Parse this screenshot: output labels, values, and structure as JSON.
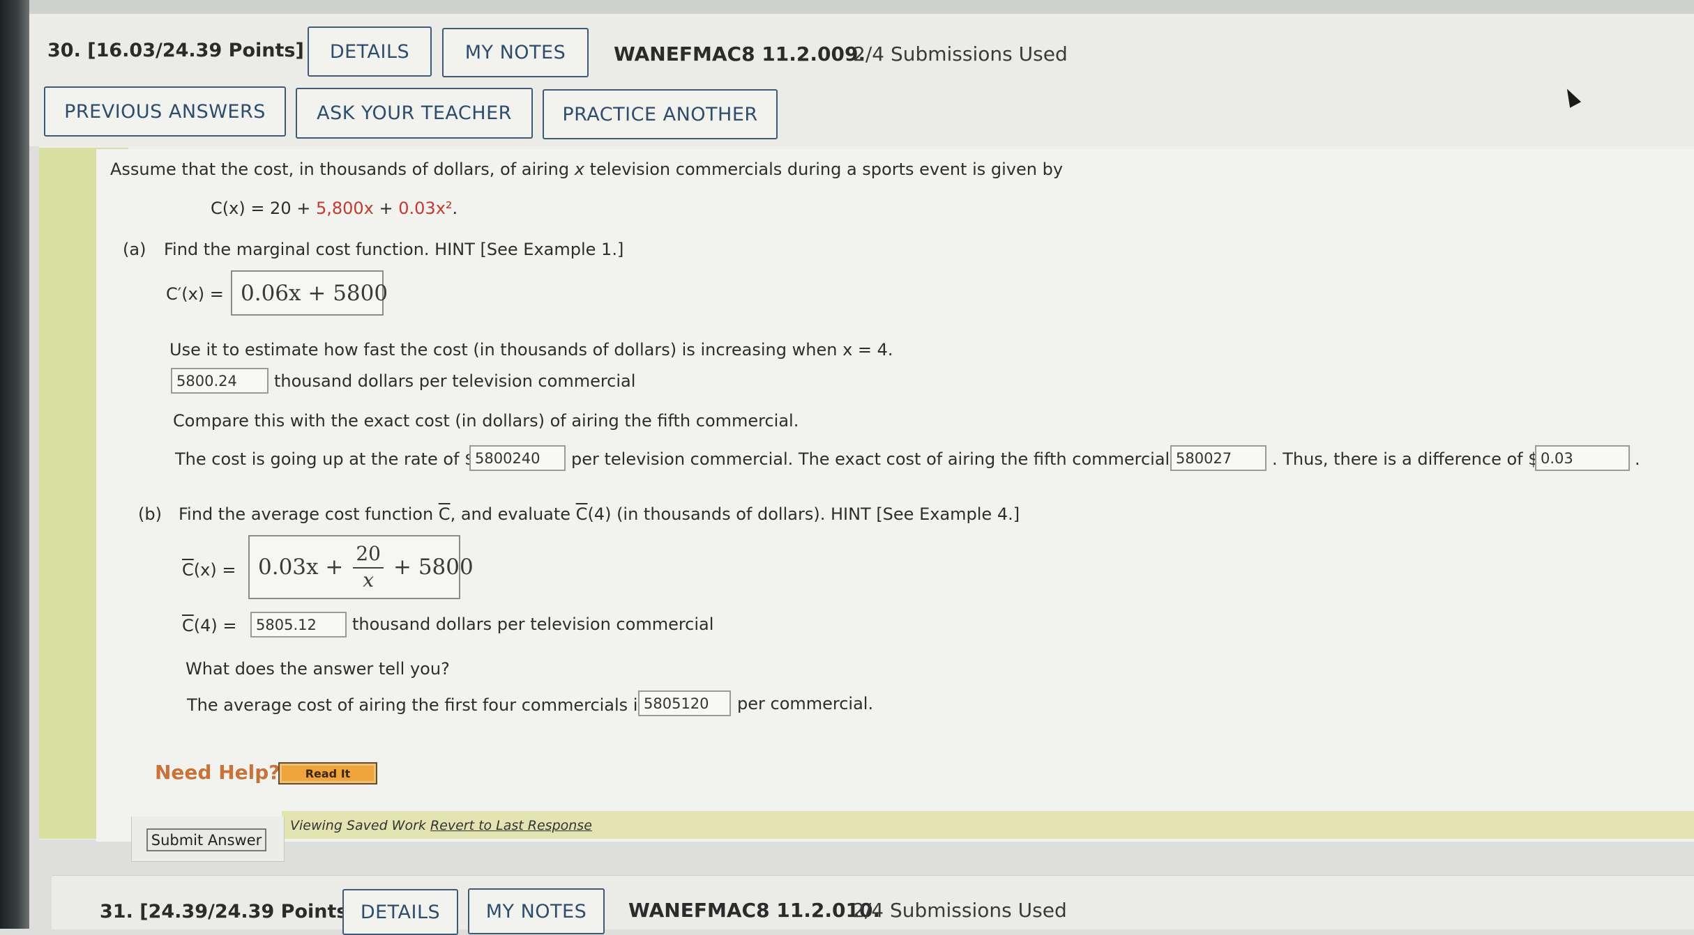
{
  "q30": {
    "number": "30.",
    "points": "[16.03/24.39 Points]",
    "details_label": "DETAILS",
    "notes_label": "MY NOTES",
    "code": "WANEFMAC8 11.2.009.",
    "submissions": "2/4 Submissions Used",
    "prev_answers_label": "PREVIOUS ANSWERS",
    "ask_teacher_label": "ASK YOUR TEACHER",
    "practice_label": "PRACTICE ANOTHER"
  },
  "problem": {
    "intro_a": "Assume that the cost, in thousands of dollars, of airing ",
    "intro_var": "x",
    "intro_b": " television commercials during a sports event is given by",
    "eq_prefix": "C(x) = 20 + ",
    "eq_term1": "5,800x",
    "eq_mid": " + ",
    "eq_term2": "0.03x²",
    "eq_end": ".",
    "part_a_label": "(a)",
    "part_a_text": "Find the marginal cost function. HINT [See Example 1.]",
    "marginal_lhs": "C′(x) =",
    "marginal_answer": "0.06x + 5800",
    "estimate_text": "Use it to estimate how fast the cost (in thousands of dollars) is increasing when x = 4.",
    "estimate_value": "5800.24",
    "estimate_unit": "thousand dollars per television commercial",
    "compare_text": "Compare this with the exact cost (in dollars) of airing the fifth commercial.",
    "rate_text_1": "The cost is going up at the rate of $",
    "rate_value": "5800240",
    "rate_text_2": "per television commercial. The exact cost of airing the fifth commercial is $",
    "exact_value": "580027",
    "rate_text_3": ". Thus, there is a difference of $",
    "difference_value": "0.03",
    "rate_text_4": ".",
    "part_b_label": "(b)",
    "part_b_text_1": "Find the average cost function ",
    "part_b_c": "C",
    "part_b_text_2": ", and evaluate ",
    "part_b_text_3": "(4) (in thousands of dollars). HINT [See Example 4.]",
    "avg_lhs_c": "C",
    "avg_lhs_rest": "(x) =",
    "avg_term1": "0.03x +",
    "avg_frac_num": "20",
    "avg_frac_den": "x",
    "avg_term2": "+ 5800",
    "avg4_lhs_c": "C",
    "avg4_lhs_rest": "(4) =",
    "avg4_value": "5805.12",
    "avg4_unit": "thousand dollars per television commercial",
    "question_text": "What does the answer tell you?",
    "avg_cost_text_1": "The average cost of airing the first four commercials is $",
    "avg_cost_value": "5805120",
    "avg_cost_text_2": "per commercial."
  },
  "help": {
    "need_help": "Need Help?",
    "read_it": "Read It"
  },
  "submit": {
    "label": "Submit Answer",
    "saved_text": "Viewing Saved Work ",
    "revert_link": "Revert to Last Response"
  },
  "q31": {
    "number": "31.",
    "points": "[24.39/24.39 Points]",
    "details_label": "DETAILS",
    "notes_label": "MY NOTES",
    "code": "WANEFMAC8 11.2.010.",
    "submissions": "2/4 Submissions Used"
  }
}
